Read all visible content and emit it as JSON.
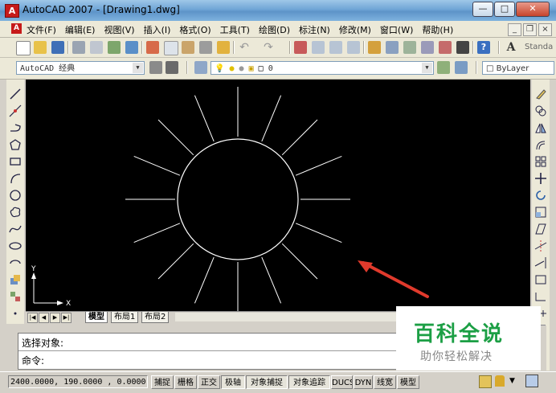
{
  "window": {
    "title": "AutoCAD 2007 - [Drawing1.dwg]",
    "app_icon_letter": "A",
    "minimize": "—",
    "maximize": "□",
    "close": "✕"
  },
  "menu": {
    "items": [
      "文件(F)",
      "编辑(E)",
      "视图(V)",
      "插入(I)",
      "格式(O)",
      "工具(T)",
      "绘图(D)",
      "标注(N)",
      "修改(M)",
      "窗口(W)",
      "帮助(H)"
    ],
    "mdi_min": "_",
    "mdi_restore": "❐",
    "mdi_close": "×"
  },
  "toolbar": {
    "text_style": "Standa"
  },
  "toolbar2": {
    "workspace": "AutoCAD 经典",
    "layer": "0",
    "color": "ByLayer"
  },
  "canvas": {
    "ucs_x": "X",
    "ucs_y": "Y"
  },
  "layout_tabs": {
    "nav": [
      "|◀",
      "◀",
      "▶",
      "▶|"
    ],
    "tabs": [
      "模型",
      "布局1",
      "布局2"
    ],
    "active": "模型"
  },
  "command": {
    "line1": "选择对象:",
    "line2": "命令:"
  },
  "watermark": {
    "title": "百科全说",
    "subtitle": "助你轻松解决"
  },
  "status": {
    "coords": "2400.0000, 190.0000 , 0.0000",
    "buttons": [
      "捕捉",
      "栅格",
      "正交",
      "极轴",
      "对象捕捉",
      "对象追踪",
      "DUCS",
      "DYN",
      "线宽",
      "模型"
    ]
  },
  "colors": {
    "canvas_bg": "#000000",
    "drawing_lines": "#ffffff",
    "annotation_arrow": "#e03a2c",
    "watermark_green": "#1c9f45"
  }
}
